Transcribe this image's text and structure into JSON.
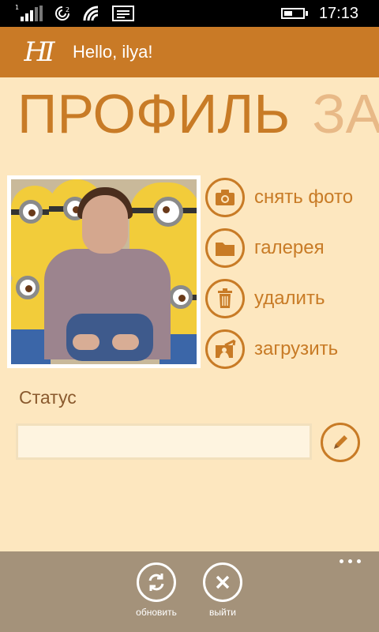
{
  "status_bar": {
    "signal_sim_number": "1",
    "time": "17:13",
    "icons": [
      "signal-icon",
      "sim-icon",
      "wifi-icon",
      "message-icon",
      "battery-icon"
    ]
  },
  "header": {
    "logo_text": "HI",
    "greeting": "Hello, ilya!"
  },
  "pivot": {
    "active": "ПРОФИЛЬ",
    "next": "ЗА"
  },
  "photo_actions": [
    {
      "label": "снять фото",
      "icon": "camera-icon"
    },
    {
      "label": "галерея",
      "icon": "folder-icon"
    },
    {
      "label": "удалить",
      "icon": "trash-icon"
    },
    {
      "label": "загрузить",
      "icon": "upload-photo-icon"
    }
  ],
  "status_section": {
    "label": "Статус",
    "value": "",
    "edit_icon": "pencil-icon"
  },
  "app_bar": {
    "buttons": [
      {
        "label": "обновить",
        "icon": "refresh-icon"
      },
      {
        "label": "выйти",
        "icon": "close-icon"
      }
    ],
    "more_icon": "more-icon"
  },
  "colors": {
    "accent": "#c87b26",
    "header_bg": "#c97a26",
    "page_bg": "#fde7bf",
    "appbar_bg": "#a4927a"
  }
}
